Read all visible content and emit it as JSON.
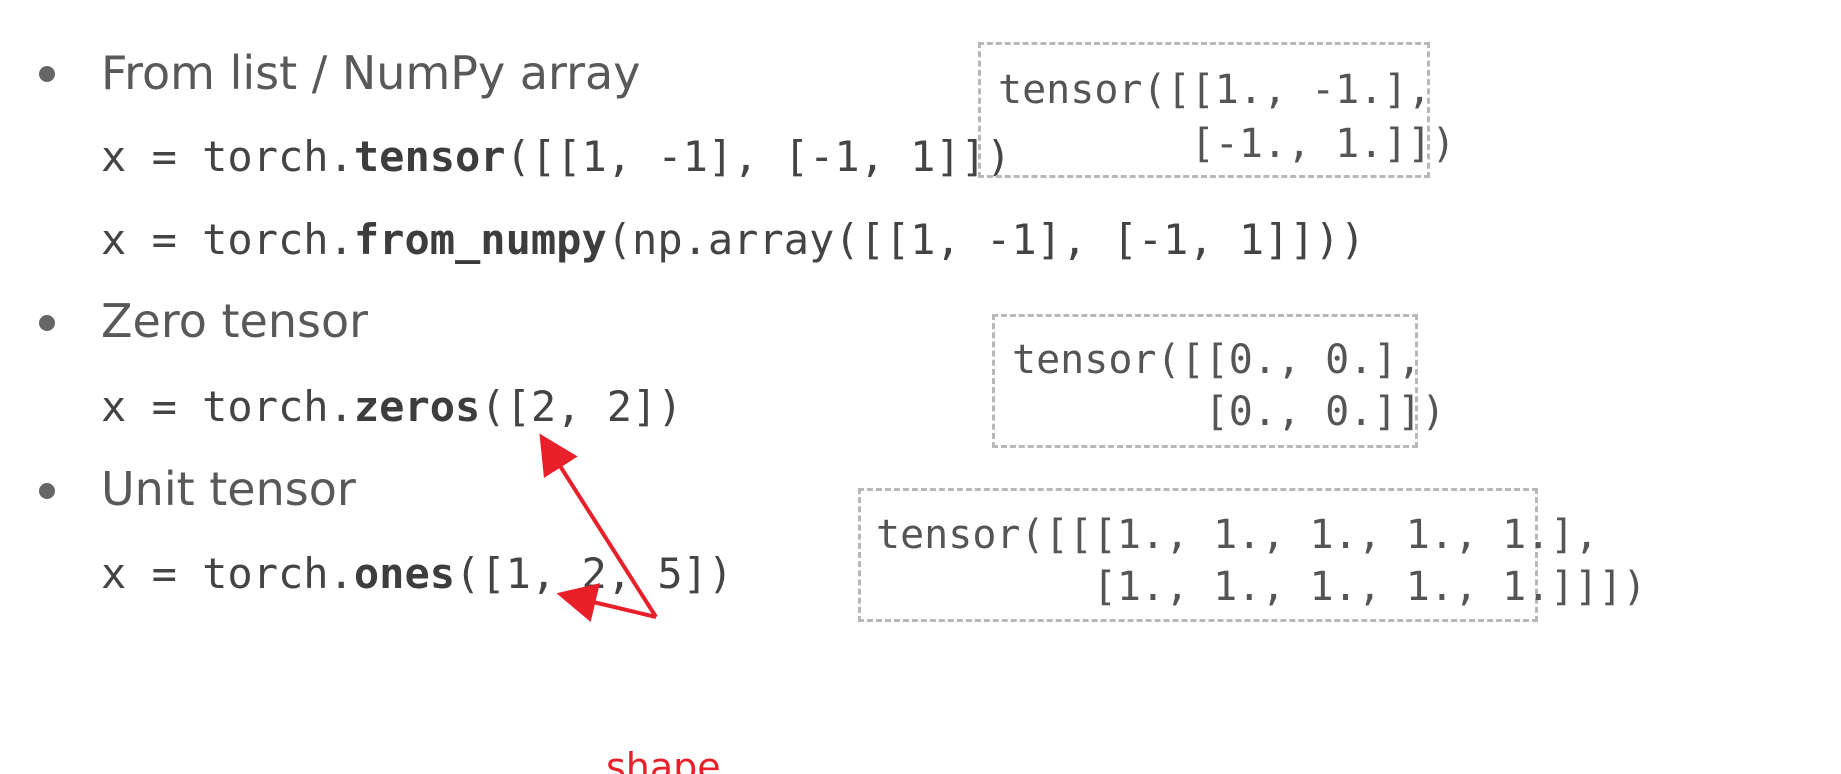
{
  "sections": [
    {
      "heading": "From list / NumPy array",
      "code_lines": [
        {
          "pre": "x = torch.",
          "fn": "tensor",
          "post": "([[1, -1], [-1, 1]])"
        },
        {
          "pre": "x = torch.",
          "fn": "from_numpy",
          "post": "(np.array([[1, -1], [-1, 1]]))"
        }
      ],
      "output_lines": [
        "tensor([[1., -1.],",
        "        [-1., 1.]])"
      ]
    },
    {
      "heading": "Zero tensor",
      "code_lines": [
        {
          "pre": "x = torch.",
          "fn": "zeros",
          "post": "([2, 2])"
        }
      ],
      "output_lines": [
        "tensor([[0., 0.],",
        "        [0., 0.]])"
      ]
    },
    {
      "heading": "Unit tensor",
      "code_lines": [
        {
          "pre": "x = torch.",
          "fn": "ones",
          "post": "([1, 2, 5])"
        }
      ],
      "output_lines": [
        "tensor([[[1., 1., 1., 1., 1.],",
        "         [1., 1., 1., 1., 1.]]])"
      ]
    }
  ],
  "annotation": {
    "label": "shape",
    "color": "#e8202a"
  }
}
